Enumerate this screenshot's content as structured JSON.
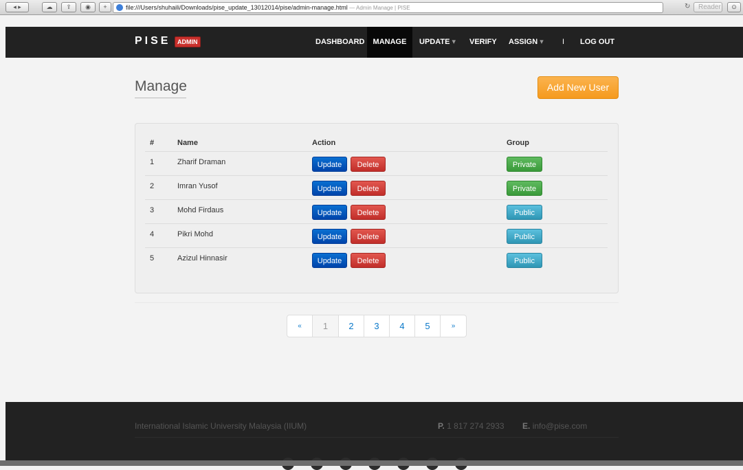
{
  "browser": {
    "url": "file:///Users/shuhaili/Downloads/pise_update_13012014/pise/admin-manage.html",
    "title_suffix": "— Admin Manage | PISE",
    "reader_label": "Reader"
  },
  "nav": {
    "logo": "PISE",
    "badge": "ADMIN",
    "items": [
      {
        "label": "DASHBOARD"
      },
      {
        "label": "MANAGE"
      },
      {
        "label": "UPDATE"
      },
      {
        "label": "VERIFY"
      },
      {
        "label": "ASSIGN"
      },
      {
        "label": "I"
      },
      {
        "label": "LOG OUT"
      }
    ],
    "caret": "▾"
  },
  "page": {
    "title": "Manage",
    "add_button": "Add New User"
  },
  "table": {
    "headers": {
      "num": "#",
      "name": "Name",
      "action": "Action",
      "group": "Group"
    },
    "rows": [
      {
        "num": "1",
        "name": "Zharif Draman",
        "update": "Update",
        "delete": "Delete",
        "group": "Private"
      },
      {
        "num": "2",
        "name": "Imran Yusof",
        "update": "Update",
        "delete": "Delete",
        "group": "Private"
      },
      {
        "num": "3",
        "name": "Mohd Firdaus",
        "update": "Update",
        "delete": "Delete",
        "group": "Public"
      },
      {
        "num": "4",
        "name": "Pikri Mohd",
        "update": "Update",
        "delete": "Delete",
        "group": "Public"
      },
      {
        "num": "5",
        "name": "Azizul Hinnasir",
        "update": "Update",
        "delete": "Delete",
        "group": "Public"
      }
    ]
  },
  "pagination": {
    "prev": "«",
    "pages": [
      "1",
      "2",
      "3",
      "4",
      "5"
    ],
    "next": "»",
    "current": "1"
  },
  "footer": {
    "org": "International Islamic University Malaysia (IIUM)",
    "phone_label": "P.",
    "phone": "1 817 274 2933",
    "email_label": "E.",
    "email": "info@pise.com"
  },
  "colors": {
    "nav_bg": "#222222",
    "accent_orange": "#f59a1e",
    "update_blue": "#0044aa",
    "delete_red": "#c12e2a",
    "private_green": "#3a9a3a",
    "public_cyan": "#2f96b4"
  }
}
